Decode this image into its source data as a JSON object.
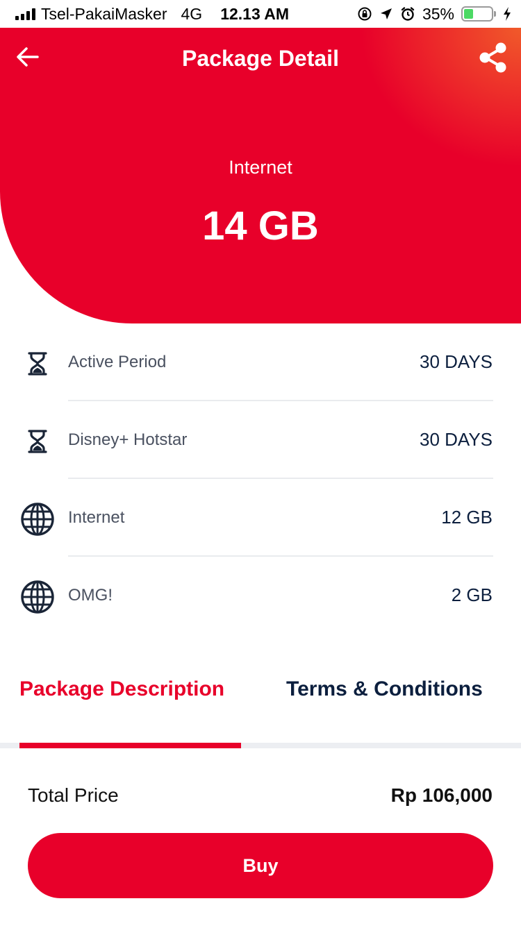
{
  "status_bar": {
    "carrier": "Tsel-PakaiMasker",
    "network": "4G",
    "time": "12.13 AM",
    "battery_percent_text": "35%",
    "battery_level": 0.35,
    "icons": [
      "signal-icon",
      "orientation-lock-icon",
      "location-arrow-icon",
      "alarm-icon",
      "battery-icon",
      "charging-bolt-icon"
    ]
  },
  "header": {
    "title": "Package Detail",
    "back_icon": "arrow-left-icon",
    "share_icon": "share-icon"
  },
  "package": {
    "category": "Internet",
    "quota": "14 GB"
  },
  "benefits": [
    {
      "icon": "hourglass-icon",
      "label": "Active Period",
      "value": "30 DAYS"
    },
    {
      "icon": "hourglass-icon",
      "label": "Disney+ Hotstar",
      "value": "30 DAYS"
    },
    {
      "icon": "globe-icon",
      "label": "Internet",
      "value": "12 GB"
    },
    {
      "icon": "globe-icon",
      "label": "OMG!",
      "value": "2 GB"
    }
  ],
  "tabs": {
    "items": [
      {
        "label": "Package Description",
        "active": true
      },
      {
        "label": "Terms & Conditions",
        "active": false
      }
    ]
  },
  "footer": {
    "total_label": "Total Price",
    "total_value": "Rp 106,000",
    "buy_label": "Buy"
  },
  "colors": {
    "brand_red": "#e8002a",
    "navy": "#0c1f3e",
    "gradient_accent": "#f05a2a"
  }
}
